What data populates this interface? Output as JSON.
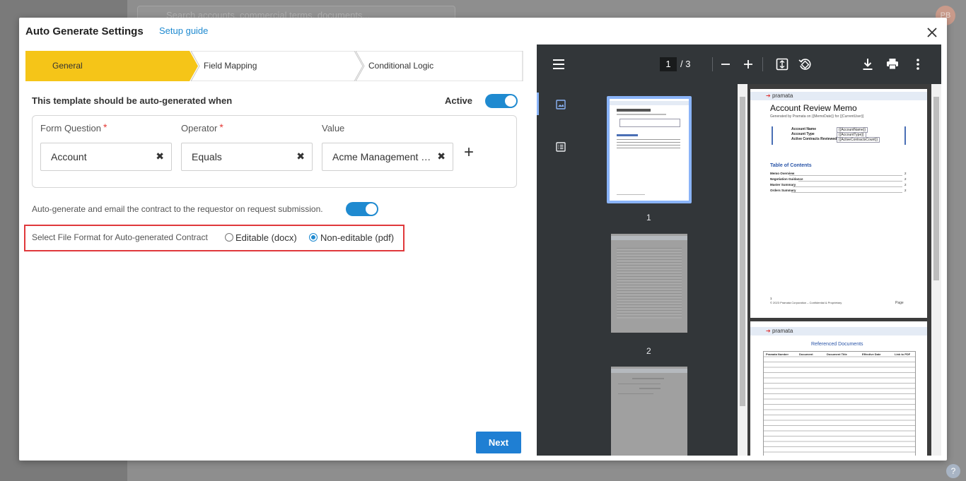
{
  "background": {
    "search_placeholder": "Search accounts, commercial terms, documents...",
    "avatar_initials": "PB",
    "help": "?"
  },
  "modal": {
    "title": "Auto Generate Settings",
    "setup_guide": "Setup guide",
    "steps": [
      {
        "label": "General",
        "active": true
      },
      {
        "label": "Field Mapping",
        "active": false
      },
      {
        "label": "Conditional Logic",
        "active": false
      }
    ],
    "section_title": "This template should be auto-generated when",
    "active_label": "Active",
    "active_on": true,
    "columns": {
      "form_question": "Form Question",
      "operator": "Operator",
      "value": "Value",
      "required_mark": "*"
    },
    "row": {
      "form_question": "Account",
      "operator": "Equals",
      "value": "Acme Management Co...",
      "clear": "✖",
      "add": "+"
    },
    "autogen_email_text": "Auto-generate and email the contract to the requestor on request submission.",
    "autogen_email_on": true,
    "file_format": {
      "label": "Select File Format for Auto-generated Contract",
      "options": [
        {
          "label": "Editable (docx)",
          "selected": false
        },
        {
          "label": "Non-editable (pdf)",
          "selected": true
        }
      ]
    },
    "next_button": "Next"
  },
  "viewer": {
    "current_page": "1",
    "page_total": "/  3",
    "thumb_numbers": [
      "1",
      "2"
    ],
    "page1": {
      "brand": "pramata",
      "title": "Account Review Memo",
      "generated": "Generated by Pramata on {{MemoDate}} for {{CurrentUser}}",
      "table": [
        [
          "Account Name",
          "{{AccountName}}"
        ],
        [
          "Account Type",
          "{{AccountType}}"
        ],
        [
          "Active Contracts Reviewed",
          "{{ActiveContractsCount}}"
        ]
      ],
      "toc_title": "Table of Contents",
      "toc": [
        [
          "Memo Overview",
          "2"
        ],
        [
          "Negotiation Guidance",
          "2"
        ],
        [
          "Master Summary",
          "2"
        ],
        [
          "Orders Summary",
          "2"
        ]
      ],
      "footer_num": "1",
      "footer_left": "© 2023 Pramata Corporation – Confidential & Proprietary",
      "footer_right": "Page"
    },
    "page2": {
      "brand": "pramata",
      "title": "Referenced Documents",
      "headers": [
        "Pramata Number",
        "Document",
        "Document Title",
        "Effective Date",
        "Link to PDF"
      ]
    },
    "colors": {
      "toolbar": "#323639",
      "accent": "#8ab4f8",
      "step_active": "#f5c518"
    }
  }
}
